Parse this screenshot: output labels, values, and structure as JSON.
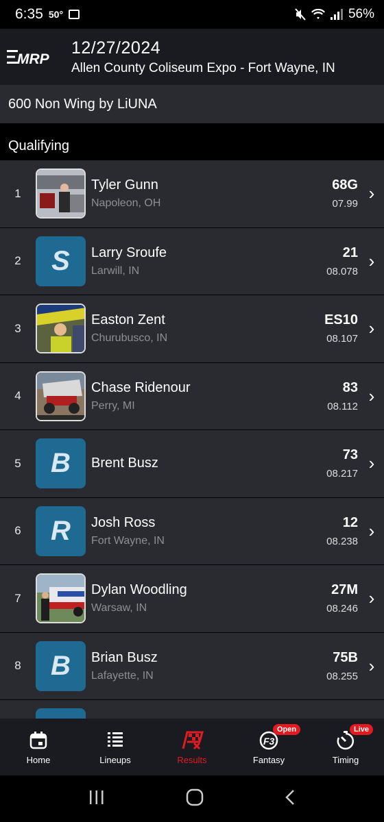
{
  "status": {
    "time": "6:35",
    "temp": "50°",
    "battery": "56%"
  },
  "header": {
    "logo": "MRP",
    "date": "12/27/2024",
    "venue": "Allen County Coliseum Expo - Fort Wayne, IN"
  },
  "class_name": "600 Non Wing by LiUNA",
  "section_title": "Qualifying",
  "rows": [
    {
      "pos": "1",
      "name": "Tyler Gunn",
      "location": "Napoleon, OH",
      "car": "68G",
      "time": "07.99",
      "avatar": "photo"
    },
    {
      "pos": "2",
      "name": "Larry Sroufe",
      "location": "Larwill, IN",
      "car": "21",
      "time": "08.078",
      "avatar": "S"
    },
    {
      "pos": "3",
      "name": "Easton Zent",
      "location": "Churubusco, IN",
      "car": "ES10",
      "time": "08.107",
      "avatar": "photo"
    },
    {
      "pos": "4",
      "name": "Chase Ridenour",
      "location": "Perry, MI",
      "car": "83",
      "time": "08.112",
      "avatar": "photo"
    },
    {
      "pos": "5",
      "name": "Brent Busz",
      "location": "",
      "car": "73",
      "time": "08.217",
      "avatar": "B"
    },
    {
      "pos": "6",
      "name": "Josh Ross",
      "location": "Fort Wayne, IN",
      "car": "12",
      "time": "08.238",
      "avatar": "R"
    },
    {
      "pos": "7",
      "name": "Dylan Woodling",
      "location": "Warsaw, IN",
      "car": "27M",
      "time": "08.246",
      "avatar": "photo"
    },
    {
      "pos": "8",
      "name": "Brian Busz",
      "location": "Lafayette, IN",
      "car": "75B",
      "time": "08.255",
      "avatar": "B"
    }
  ],
  "tabs": {
    "home": "Home",
    "lineups": "Lineups",
    "results": "Results",
    "fantasy": "Fantasy",
    "fantasy_badge": "Open",
    "timing": "Timing",
    "timing_badge": "Live"
  },
  "colors": {
    "accent": "#e11b22",
    "avatar_blue": "#1f6a93",
    "row_bg": "#2a2b30",
    "header_bg": "#1a1b20"
  },
  "icons": {
    "home": "calendar-icon",
    "lineups": "list-icon",
    "results": "checkered-flag-icon",
    "fantasy": "f3-icon",
    "timing": "stopwatch-icon",
    "row": "chevron-right-icon"
  }
}
